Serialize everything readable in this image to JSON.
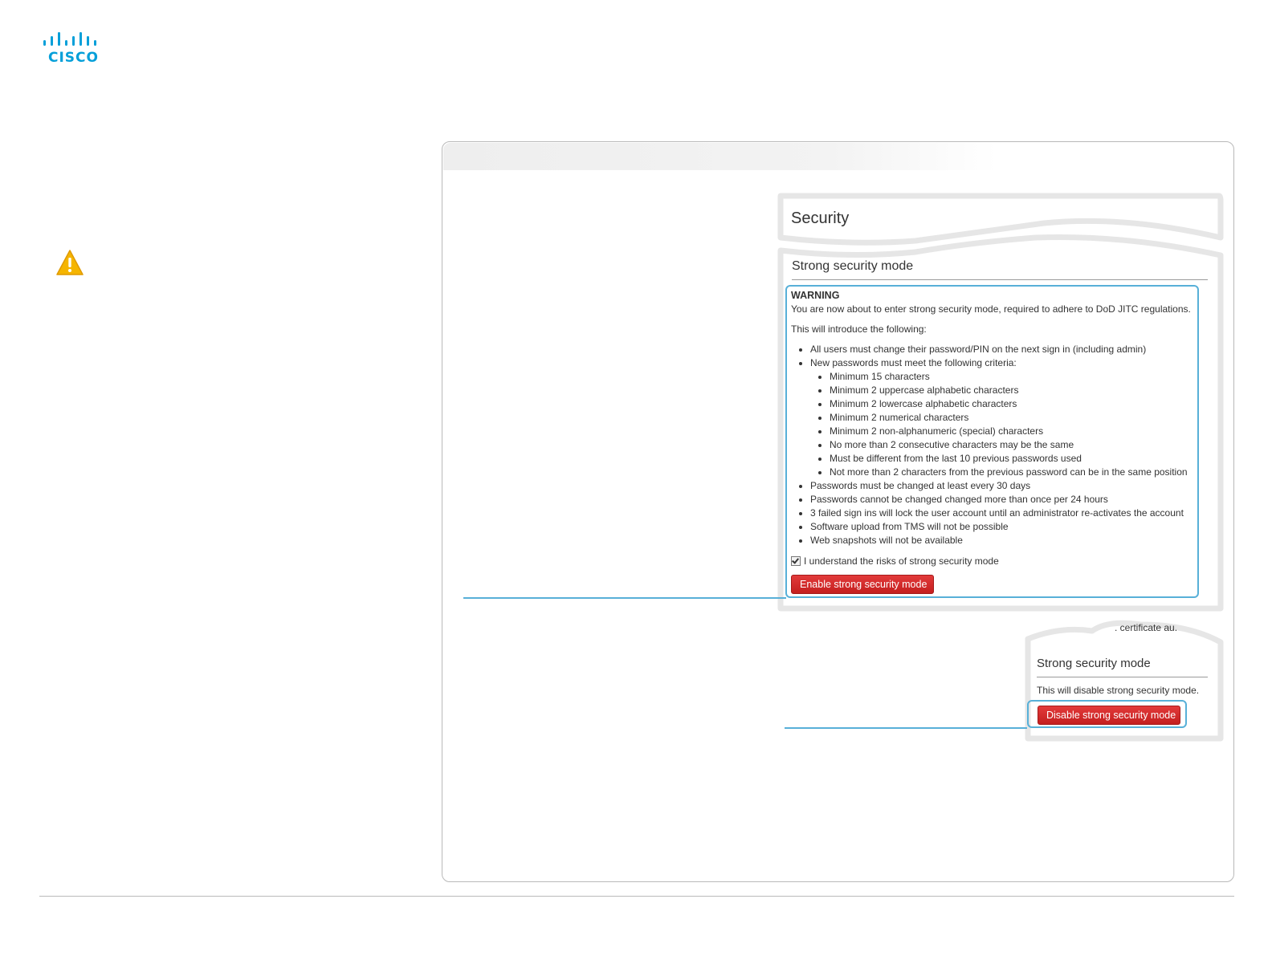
{
  "brand": {
    "logo_text": "CISCO",
    "color": "#049fd9"
  },
  "icons": {
    "logo": "cisco-bridge-logo-icon",
    "warning": "warning-triangle-icon",
    "checkbox": "checkmark-icon"
  },
  "panel_security": {
    "title": "Security",
    "section_title": "Strong security mode",
    "warning_title": "WARNING",
    "intro": "You are now about to enter strong security mode, required to adhere to DoD JITC regulations.",
    "introduce": "This will introduce the following:",
    "items": [
      {
        "text": "All users must change their password/PIN on the next sign in (including admin)",
        "sub": []
      },
      {
        "text": "New passwords must meet the following criteria:",
        "sub": [
          "Minimum 15 characters",
          "Minimum 2 uppercase alphabetic characters",
          "Minimum 2 lowercase alphabetic characters",
          "Minimum 2 numerical characters",
          "Minimum 2 non-alphanumeric (special) characters",
          "No more than 2 consecutive characters may be the same",
          "Must be different from the last 10 previous passwords used",
          "Not more than 2 characters from the previous password can be in the same position"
        ]
      },
      {
        "text": "Passwords must be changed at least every 30 days",
        "sub": []
      },
      {
        "text": "Passwords cannot be changed changed more than once per 24 hours",
        "sub": []
      },
      {
        "text": "3 failed sign ins will lock the user account until an administrator re-activates the account",
        "sub": []
      },
      {
        "text": "Software upload from TMS will not be possible",
        "sub": []
      },
      {
        "text": "Web snapshots will not be available",
        "sub": []
      }
    ],
    "checkbox_label": "I understand the risks of strong security mode",
    "checkbox_checked": true,
    "enable_button": "Enable strong security mode"
  },
  "panel_disable": {
    "top_fragment": ". certificate au.",
    "section_title": "Strong security mode",
    "note": "This will disable strong security mode.",
    "disable_button": "Disable strong security mode"
  },
  "colors": {
    "accent_blue": "#58b0d8",
    "button_red": "#c41f1f",
    "warning_yellow": "#f5b500"
  }
}
